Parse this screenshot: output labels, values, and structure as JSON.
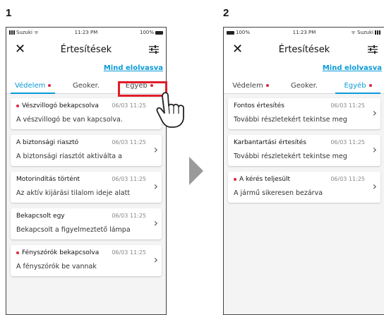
{
  "steps": [
    "1",
    "2"
  ],
  "accent_color": "#0a9bd8",
  "unread_color": "#e0263a",
  "highlight_color": "#e01e2a",
  "screen1": {
    "status": {
      "carrier": "Suzuki",
      "time": "11:23 PM",
      "battery": "100%"
    },
    "title": "Értesítések",
    "mark_all": "Mind elolvasva",
    "tabs": [
      {
        "label": "Védelem",
        "active": true,
        "dot": true
      },
      {
        "label": "Geoker.",
        "active": false,
        "dot": false
      },
      {
        "label": "Egyéb",
        "active": false,
        "dot": true
      }
    ],
    "items": [
      {
        "title": "Vészvillogó bekapcsolva",
        "time": "06/03 11:25",
        "body": "A vészvillogó be van kapcsolva.",
        "unread": true
      },
      {
        "title": "A biztonsági riasztó",
        "time": "06/03 11:25",
        "body": "A biztonsági riasztót aktiválta a",
        "unread": false
      },
      {
        "title": "Motorindítás történt",
        "time": "06/03 11:25",
        "body": "Az aktív kijárási tilalom ideje alatt",
        "unread": false
      },
      {
        "title": "Bekapcsolt egy",
        "time": "06/03 11:25",
        "body": "Bekapcsolt a figyelmeztető lámpa",
        "unread": false
      },
      {
        "title": "Fényszórók bekapcsolva",
        "time": "06/03 11:25",
        "body": "A fényszórók be vannak",
        "unread": true
      }
    ]
  },
  "screen2": {
    "status": {
      "carrier": "Suzuki",
      "time": "11:23 PM",
      "battery": "100%"
    },
    "title": "Értesítések",
    "mark_all": "Mind elolvasva",
    "tabs": [
      {
        "label": "Védelem",
        "active": false,
        "dot": true
      },
      {
        "label": "Geoker.",
        "active": false,
        "dot": false
      },
      {
        "label": "Egyéb",
        "active": true,
        "dot": true
      }
    ],
    "items": [
      {
        "title": "Fontos értesítés",
        "time": "06/03 11:25",
        "body": "További részletekért tekintse meg",
        "unread": false
      },
      {
        "title": "Karbantartási értesítés",
        "time": "06/03 11:25",
        "body": "További részletekért tekintse meg",
        "unread": false
      },
      {
        "title": "A kérés teljesült",
        "time": "06/03 11:25",
        "body": "A jármű sikeresen bezárva",
        "unread": true
      }
    ]
  },
  "icons": {
    "close": "close-icon",
    "filter": "filter-icon",
    "chevron": "chevron-right-icon",
    "hand": "pointing-hand-icon",
    "arrow": "arrow-right-icon"
  }
}
